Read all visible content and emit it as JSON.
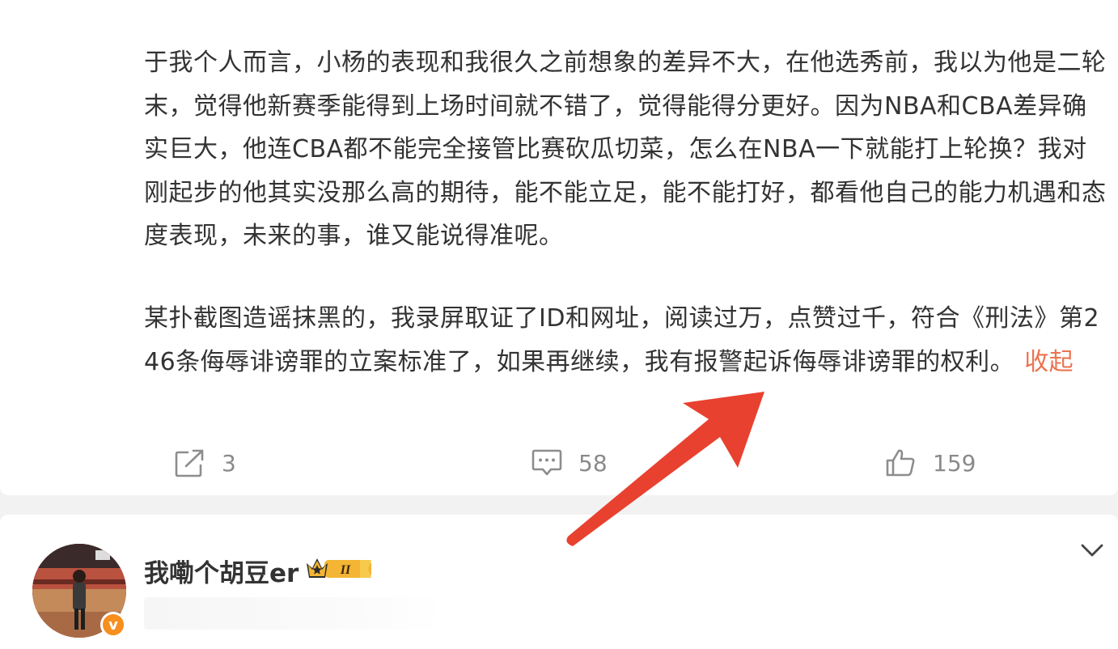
{
  "post": {
    "paragraph_1": "于我个人而言，小杨的表现和我很久之前想象的差异不大，在他选秀前，我以为他是二轮末，觉得他新赛季能得到上场时间就不错了，觉得能得分更好。因为NBA和CBA差异确实巨大，他连CBA都不能完全接管比赛砍瓜切菜，怎么在NBA一下就能打上轮换？我对刚起步的他其实没那么高的期待，能不能立足，能不能打好，都看他自己的能力机遇和态度表现，未来的事，谁又能说得准呢。",
    "paragraph_2": "某扑截图造谣抹黑的，我录屏取证了ID和网址，阅读过万，点赞过千，符合《刑法》第246条侮辱诽谤罪的立案标准了，如果再继续，我有报警起诉侮辱诽谤罪的权利。",
    "collapse_label": "收起"
  },
  "actions": {
    "repost_count": "3",
    "comment_count": "58",
    "like_count": "159",
    "icons": {
      "repost": "share-icon",
      "comment": "comment-icon",
      "like": "thumbs-up-icon"
    }
  },
  "user": {
    "name": "我嘞个胡豆er",
    "vip_level": "II",
    "verified_mark": "v"
  },
  "colors": {
    "accent_link": "#eb7350",
    "text_primary": "#333333",
    "text_muted": "#8a8a8a",
    "annotation_arrow": "#e8412f",
    "verified_badge": "#f78e1e",
    "vip_gold": "#f3b533"
  }
}
